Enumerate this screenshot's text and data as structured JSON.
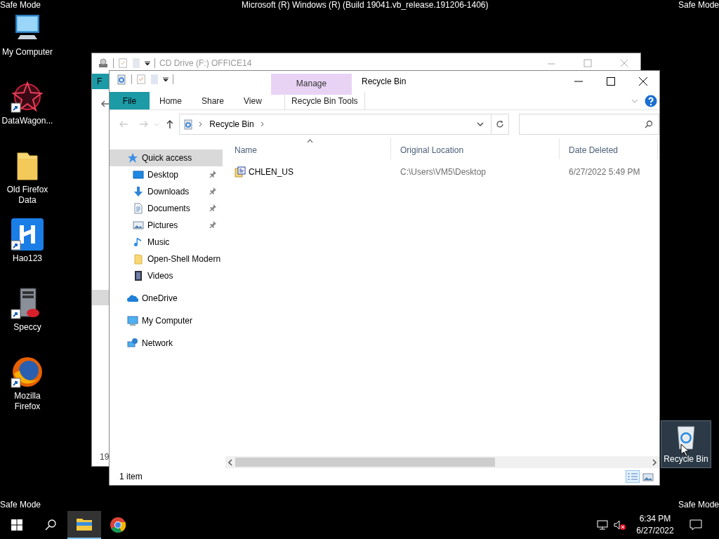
{
  "screen_overlay": {
    "top_left": "Safe Mode",
    "top_center": "Microsoft (R) Windows (R) (Build 19041.vb_release.191206-1406)",
    "top_right": "Safe Mode",
    "bottom_left": "Safe Mode",
    "bottom_right": "Safe Mode"
  },
  "desktop_icons": [
    {
      "kind": "computer",
      "label": "My Computer",
      "shortcut": false,
      "selected": false
    },
    {
      "kind": "datawagon",
      "label": "DataWagon...",
      "shortcut": true,
      "selected": false
    },
    {
      "kind": "folder",
      "label": "Old Firefox Data",
      "shortcut": false,
      "selected": false
    },
    {
      "kind": "hao123",
      "label": "Hao123",
      "shortcut": true,
      "selected": false
    },
    {
      "kind": "speccy",
      "label": "Speccy",
      "shortcut": true,
      "selected": false
    },
    {
      "kind": "firefox",
      "label": "Mozilla Firefox",
      "shortcut": true,
      "selected": false
    }
  ],
  "recycle_bin_icon": {
    "label": "Recycle Bin",
    "selected": true
  },
  "back_window": {
    "title": "CD Drive (F:) OFFICE14",
    "file_tab": "F",
    "status_text": "19"
  },
  "window": {
    "title": "Recycle Bin",
    "context_group": "Manage",
    "ribbon_tabs": [
      {
        "kind": "file",
        "label": "File"
      },
      {
        "kind": "normal",
        "label": "Home"
      },
      {
        "kind": "normal",
        "label": "Share"
      },
      {
        "kind": "normal",
        "label": "View"
      },
      {
        "kind": "context",
        "label": "Recycle Bin Tools"
      }
    ],
    "address": [
      "Recycle Bin"
    ],
    "navigation": [
      {
        "kind": "quick",
        "label": "Quick access",
        "selected": true,
        "children": [
          {
            "kind": "desktop",
            "label": "Desktop",
            "pinned": true,
            "selected": false
          },
          {
            "kind": "downloads",
            "label": "Downloads",
            "pinned": true,
            "selected": false
          },
          {
            "kind": "documents",
            "label": "Documents",
            "pinned": true,
            "selected": false
          },
          {
            "kind": "pictures",
            "label": "Pictures",
            "pinned": true,
            "selected": false
          },
          {
            "kind": "music",
            "label": "Music",
            "pinned": false,
            "selected": false
          },
          {
            "kind": "folder",
            "label": "Open-Shell Modern",
            "pinned": false,
            "selected": false
          },
          {
            "kind": "videos",
            "label": "Videos",
            "pinned": false,
            "selected": false
          }
        ]
      },
      {
        "kind": "onedrive",
        "label": "OneDrive",
        "selected": false
      },
      {
        "kind": "computer",
        "label": "My Computer",
        "selected": false
      },
      {
        "kind": "network",
        "label": "Network",
        "selected": false
      }
    ],
    "columns": [
      {
        "label": "Name",
        "sorted": true
      },
      {
        "label": "Original Location",
        "sorted": false
      },
      {
        "label": "Date Deleted",
        "sorted": false
      }
    ],
    "rows": [
      {
        "name": "CHLEN_US",
        "original_location": "C:\\Users\\VM5\\Desktop",
        "date_deleted": "6/27/2022 5:49 PM",
        "selected": false
      }
    ],
    "status": "1 item",
    "views": [
      {
        "kind": "details",
        "selected": true
      },
      {
        "kind": "large_icons",
        "selected": false
      }
    ]
  },
  "taskbar": {
    "apps": [
      {
        "kind": "explorer",
        "active": true
      },
      {
        "kind": "chrome",
        "active": false
      }
    ],
    "volume_muted": true,
    "time": "6:34 PM",
    "date": "6/27/2022"
  }
}
